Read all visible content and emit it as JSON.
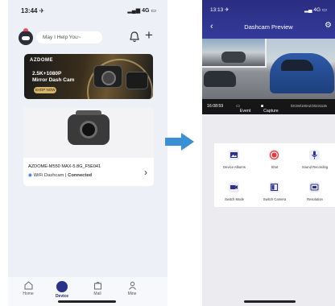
{
  "left_phone": {
    "status": {
      "time": "13:44 ✈",
      "signal": "▂▄▆ 4G ▭"
    },
    "header": {
      "greeting": "May I Help You~"
    },
    "banner": {
      "brand": "AZDOME",
      "line1": "2.5K+1080P",
      "line2": "Mirror Dash Cam",
      "button": "SHOP NOW"
    },
    "device": {
      "name": "AZDOME-M550 MAX-5.8G_F5E041",
      "wifi_label": "WiFi Dashcam",
      "separator": "|",
      "status": "Connected"
    },
    "tabs": [
      {
        "label": "Home",
        "icon": "home-icon"
      },
      {
        "label": "Device",
        "icon": "device-icon"
      },
      {
        "label": "Mall",
        "icon": "bag-icon"
      },
      {
        "label": "Mine",
        "icon": "person-icon"
      }
    ],
    "active_tab": "Device"
  },
  "right_phone": {
    "status": {
      "time": "13:13 ✈",
      "signal": "▂▄ 4G ▭"
    },
    "title": "Dashcam Preview",
    "video_bar": {
      "time": "16:08:59",
      "event": "Event",
      "capture": "Capture",
      "path": "/DCIM/100AZ/20231126"
    },
    "controls": [
      {
        "label": "Device Albums",
        "icon": "album-icon"
      },
      {
        "label": "Shot",
        "icon": "record-icon"
      },
      {
        "label": "Sound Recording",
        "icon": "microphone-icon"
      },
      {
        "label": "Switch Mode",
        "icon": "video-camera-icon"
      },
      {
        "label": "Switch Camera",
        "icon": "switch-camera-icon"
      },
      {
        "label": "Resolution",
        "icon": "resolution-icon"
      }
    ]
  },
  "colors": {
    "accent": "#2b3386",
    "record": "#e53935",
    "arrow": "#3b8fd4"
  }
}
